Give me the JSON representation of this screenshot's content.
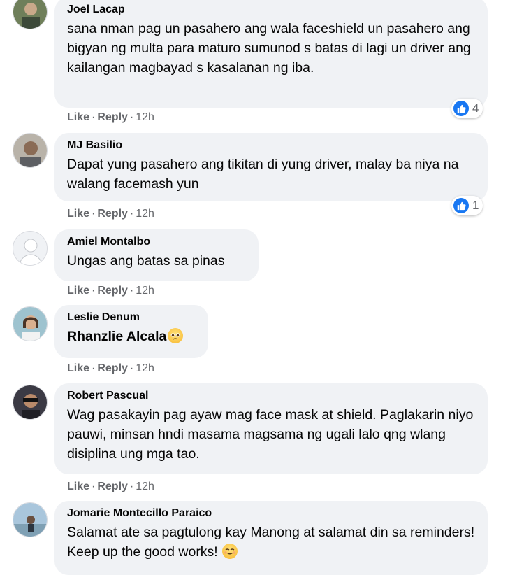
{
  "actions": {
    "like": "Like",
    "reply": "Reply",
    "separator": "·"
  },
  "comments": [
    {
      "author": "Joel Lacap",
      "text": "sana nman pag un pasahero ang wala faceshield un pasahero ang bigyan ng multa para maturo sumunod s batas di lagi un driver ang kailangan magbayad s kasalanan ng iba.",
      "time": "12h",
      "reactions": "4"
    },
    {
      "author": "MJ Basilio",
      "text": "Dapat yung pasahero ang tikitan di yung driver, malay ba niya na walang facemash yun",
      "time": "12h",
      "reactions": "1"
    },
    {
      "author": "Amiel Montalbo",
      "text": "Ungas ang batas sa pinas",
      "time": "12h"
    },
    {
      "author": "Leslie Denum",
      "mention": "Rhanzlie Alcala",
      "emoji": "pleading-face",
      "time": "12h"
    },
    {
      "author": "Robert Pascual",
      "text": "Wag pasakayin pag ayaw mag face mask at shield. Paglakarin niyo pauwi, minsan hndi masama magsama ng ugali lalo qng wlang disiplina ung mga tao.",
      "time": "12h"
    },
    {
      "author": "Jomarie Montecillo Paraico",
      "text": "Salamat ate sa pagtulong kay Manong at salamat din sa reminders! Keep up the good works!",
      "emoji": "smiling-face"
    }
  ],
  "colors": {
    "bubble": "#f0f2f5",
    "secondary_text": "#65676b",
    "like_blue": "#1877f2"
  }
}
